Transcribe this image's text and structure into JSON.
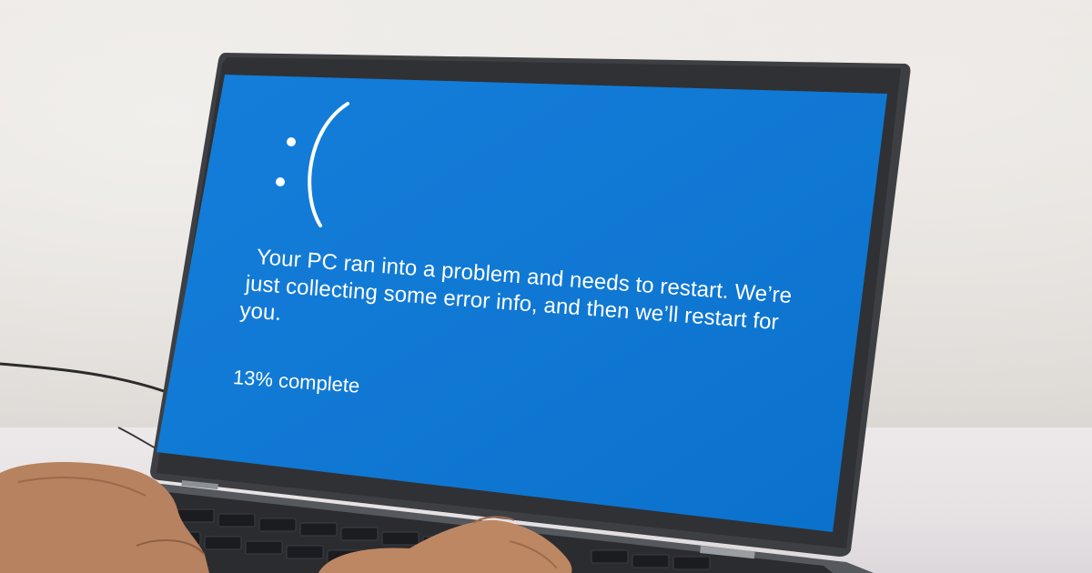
{
  "screen": {
    "background_color": "#0078d7",
    "text_color": "#ffffff",
    "sad_face": ":(",
    "message_lines": [
      "Your PC ran into a problem and needs to restart. We’re",
      "just collecting some error info, and then we’ll restart for",
      "you."
    ],
    "progress_text": "13% complete",
    "progress_percent": 13
  },
  "scene": {
    "device": "laptop-icon",
    "hands": "hand-icon",
    "cable": "cable-icon"
  }
}
